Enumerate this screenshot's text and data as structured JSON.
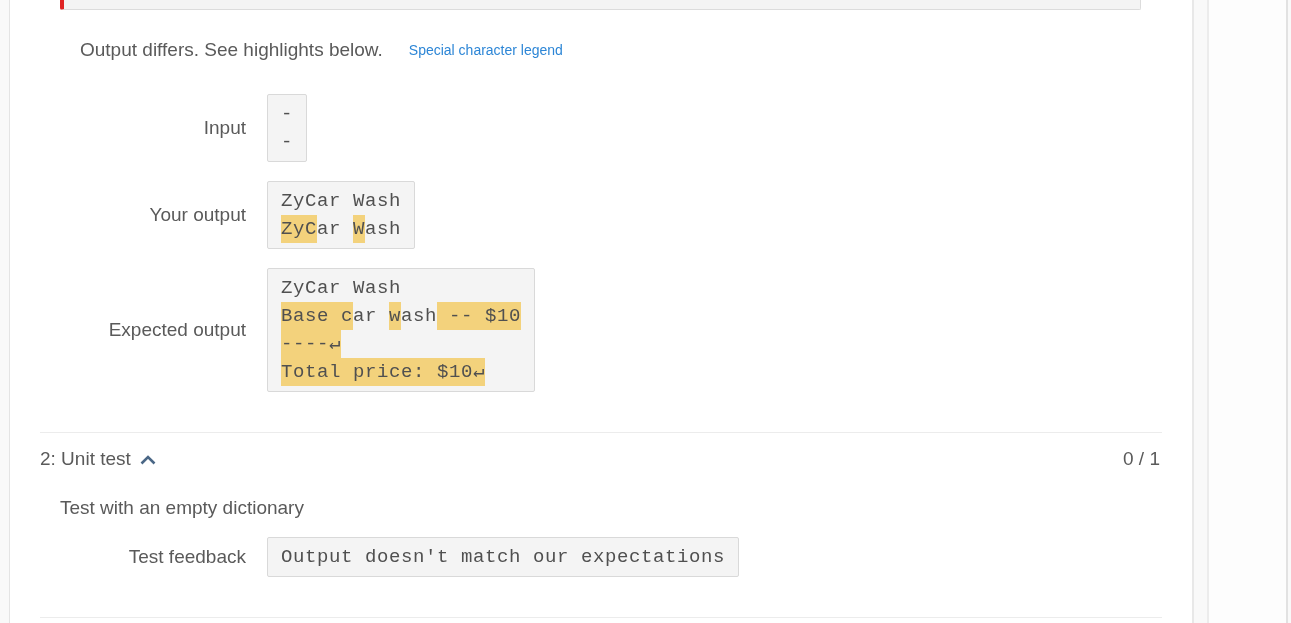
{
  "tests": [
    {
      "kind": "compare_output",
      "passed": false,
      "message": "Output differs. See highlights below.",
      "legend_link": "Special character legend",
      "rows": [
        {
          "label": "Input",
          "lines": [
            [
              {
                "text": "-",
                "highlight": false
              }
            ],
            [
              {
                "text": "-",
                "highlight": false
              }
            ]
          ]
        },
        {
          "label": "Your output",
          "lines": [
            [
              {
                "text": "ZyCar Wash",
                "highlight": false
              }
            ],
            [
              {
                "text": "ZyC",
                "highlight": true
              },
              {
                "text": "ar ",
                "highlight": false
              },
              {
                "text": "W",
                "highlight": true
              },
              {
                "text": "ash",
                "highlight": false
              }
            ]
          ]
        },
        {
          "label": "Expected output",
          "lines": [
            [
              {
                "text": "ZyCar Wash",
                "highlight": false
              }
            ],
            [
              {
                "text": "Base c",
                "highlight": true
              },
              {
                "text": "ar ",
                "highlight": false
              },
              {
                "text": "w",
                "highlight": true
              },
              {
                "text": "ash",
                "highlight": false
              },
              {
                "text": " -- $10",
                "highlight": true
              }
            ],
            [
              {
                "text": "----↵",
                "highlight": true
              }
            ],
            [
              {
                "text": "Total price: $10↵",
                "highlight": true
              }
            ]
          ]
        }
      ]
    },
    {
      "kind": "unit_test",
      "title": "2: Unit test",
      "expanded": true,
      "score": "0 / 1",
      "description": "Test with an empty dictionary",
      "feedback_label": "Test feedback",
      "feedback": "Output doesn't match our expectations"
    }
  ]
}
